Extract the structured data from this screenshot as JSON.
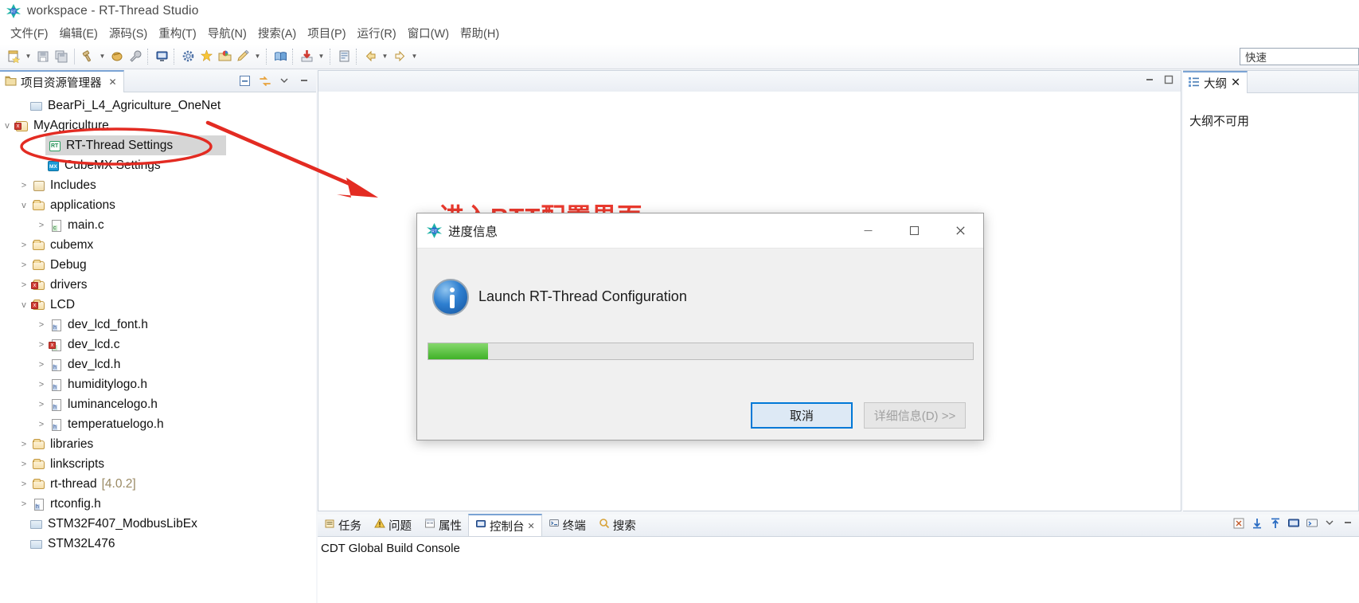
{
  "window": {
    "title": "workspace - RT-Thread Studio",
    "logo_icon": "rt-thread-logo-icon"
  },
  "menubar": {
    "items": [
      {
        "label": "文件(F)",
        "name": "menu-file"
      },
      {
        "label": "编辑(E)",
        "name": "menu-edit"
      },
      {
        "label": "源码(S)",
        "name": "menu-source"
      },
      {
        "label": "重构(T)",
        "name": "menu-refactor"
      },
      {
        "label": "导航(N)",
        "name": "menu-navigate"
      },
      {
        "label": "搜索(A)",
        "name": "menu-search"
      },
      {
        "label": "项目(P)",
        "name": "menu-project"
      },
      {
        "label": "运行(R)",
        "name": "menu-run"
      },
      {
        "label": "窗口(W)",
        "name": "menu-window"
      },
      {
        "label": "帮助(H)",
        "name": "menu-help"
      }
    ]
  },
  "toolbar": {
    "icons": [
      "new-file-icon",
      "dropdown-arrow-icon",
      "save-icon",
      "save-all-icon",
      "build-hammer-icon",
      "dropdown-arrow-icon",
      "build-config-icon",
      "wrench-icon",
      "console-icon",
      "settings-gear-icon",
      "new-project-icon",
      "open-package-icon",
      "pencil-icon",
      "dropdown-arrow-icon",
      "book-icon",
      "download-icon",
      "dropdown-arrow-icon",
      "sdk-manager-icon",
      "back-arrow-icon",
      "dropdown-arrow-icon",
      "forward-arrow-icon",
      "dropdown-arrow-icon"
    ],
    "quick_access": "快速"
  },
  "project_explorer": {
    "tab_label": "项目资源管理器",
    "tab_icon": "project-explorer-icon",
    "close_label": "✕",
    "actions": [
      "collapse-all-icon",
      "link-editor-icon",
      "view-menu-icon",
      "minimize-icon"
    ],
    "tree": [
      {
        "label": "BearPi_L4_Agriculture_OneNet",
        "indent": 0,
        "twisty": "",
        "icon": "closed-project-icon",
        "selected": false
      },
      {
        "label": "MyAgriculture",
        "indent": 0,
        "twisty": "v",
        "icon": "open-project-icon",
        "selected": false
      },
      {
        "label": "RT-Thread Settings",
        "indent": 1,
        "twisty": "",
        "icon": "rt-thread-settings-icon",
        "selected": true
      },
      {
        "label": "CubeMX Settings",
        "indent": 1,
        "twisty": "",
        "icon": "cubemx-settings-icon",
        "selected": false
      },
      {
        "label": "Includes",
        "indent": 1,
        "twisty": ">",
        "icon": "includes-icon",
        "selected": false
      },
      {
        "label": "applications",
        "indent": 1,
        "twisty": "v",
        "icon": "folder-icon",
        "selected": false
      },
      {
        "label": "main.c",
        "indent": 2,
        "twisty": ">",
        "icon": "c-file-icon",
        "selected": false
      },
      {
        "label": "cubemx",
        "indent": 1,
        "twisty": ">",
        "icon": "folder-icon",
        "selected": false
      },
      {
        "label": "Debug",
        "indent": 1,
        "twisty": ">",
        "icon": "folder-icon",
        "selected": false
      },
      {
        "label": "drivers",
        "indent": 1,
        "twisty": ">",
        "icon": "source-folder-icon",
        "selected": false
      },
      {
        "label": "LCD",
        "indent": 1,
        "twisty": "v",
        "icon": "source-folder-icon",
        "selected": false
      },
      {
        "label": "dev_lcd_font.h",
        "indent": 2,
        "twisty": ">",
        "icon": "h-file-icon",
        "selected": false
      },
      {
        "label": "dev_lcd.c",
        "indent": 2,
        "twisty": ">",
        "icon": "c-file-icon",
        "selected": false
      },
      {
        "label": "dev_lcd.h",
        "indent": 2,
        "twisty": ">",
        "icon": "h-file-icon",
        "selected": false
      },
      {
        "label": "humiditylogo.h",
        "indent": 2,
        "twisty": ">",
        "icon": "h-file-icon",
        "selected": false
      },
      {
        "label": "luminancelogo.h",
        "indent": 2,
        "twisty": ">",
        "icon": "h-file-icon",
        "selected": false
      },
      {
        "label": "temperatuelogo.h",
        "indent": 2,
        "twisty": ">",
        "icon": "h-file-icon",
        "selected": false
      },
      {
        "label": "libraries",
        "indent": 1,
        "twisty": ">",
        "icon": "folder-icon",
        "selected": false
      },
      {
        "label": "linkscripts",
        "indent": 1,
        "twisty": ">",
        "icon": "folder-icon",
        "selected": false
      },
      {
        "label": "rt-thread",
        "indent": 1,
        "twisty": ">",
        "icon": "folder-icon",
        "selected": false,
        "version": "[4.0.2]"
      },
      {
        "label": "rtconfig.h",
        "indent": 1,
        "twisty": ">",
        "icon": "h-file-icon",
        "selected": false
      },
      {
        "label": "STM32F407_ModbusLibEx",
        "indent": 0,
        "twisty": "",
        "icon": "closed-project-icon",
        "selected": false
      },
      {
        "label": "STM32L476",
        "indent": 0,
        "twisty": "",
        "icon": "closed-project-icon",
        "selected": false
      }
    ]
  },
  "editor": {
    "annotation_text": "进入RTT配置界面",
    "annotation_color": "#ec3a2e",
    "minimize_icon": "minimize-icon",
    "maximize_icon": "maximize-icon"
  },
  "outline": {
    "tab_label": "大纲",
    "tab_icon": "outline-icon",
    "close_label": "✕",
    "empty_text": "大纲不可用"
  },
  "console": {
    "tabs": [
      {
        "label": "任务",
        "icon": "tasks-icon",
        "active": false,
        "closable": false
      },
      {
        "label": "问题",
        "icon": "problems-icon",
        "active": false,
        "closable": false
      },
      {
        "label": "属性",
        "icon": "properties-icon",
        "active": false,
        "closable": false
      },
      {
        "label": "控制台",
        "icon": "console-icon",
        "active": true,
        "closable": true
      },
      {
        "label": "终端",
        "icon": "terminal-icon",
        "active": false,
        "closable": false
      },
      {
        "label": "搜索",
        "icon": "search-icon",
        "active": false,
        "closable": false
      }
    ],
    "body_text": "CDT Global Build Console",
    "actions": [
      "clear-console-icon",
      "scroll-lock-icon",
      "pin-console-icon",
      "display-console-icon",
      "open-console-icon",
      "view-menu-icon",
      "minimize-icon"
    ]
  },
  "dialog": {
    "title": "进度信息",
    "logo_icon": "rt-thread-logo-icon",
    "minimize_label": "—",
    "maximize_label": "☐",
    "close_label": "✕",
    "info_icon": "info-icon",
    "message": "Launch RT-Thread Configuration",
    "progress_percent": 11,
    "progress_color": "#3fb228",
    "cancel_label": "取消",
    "details_label": "详细信息(D) >>"
  }
}
